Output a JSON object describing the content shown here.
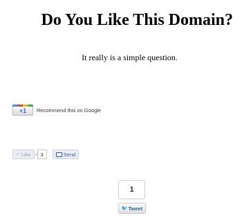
{
  "page": {
    "title": "Do You Like This Domain?",
    "subtitle": "It really is a simple question."
  },
  "google_plus": {
    "button_label": "+1",
    "text": "Recommend this on Google"
  },
  "facebook": {
    "like_label": "Like",
    "like_count": "3",
    "send_label": "Send"
  },
  "twitter": {
    "count": "1",
    "tweet_label": "Tweet"
  },
  "colors": {
    "google_blue": "#4285f4",
    "facebook_blue": "#3b5998",
    "twitter_blue": "#55acee"
  }
}
